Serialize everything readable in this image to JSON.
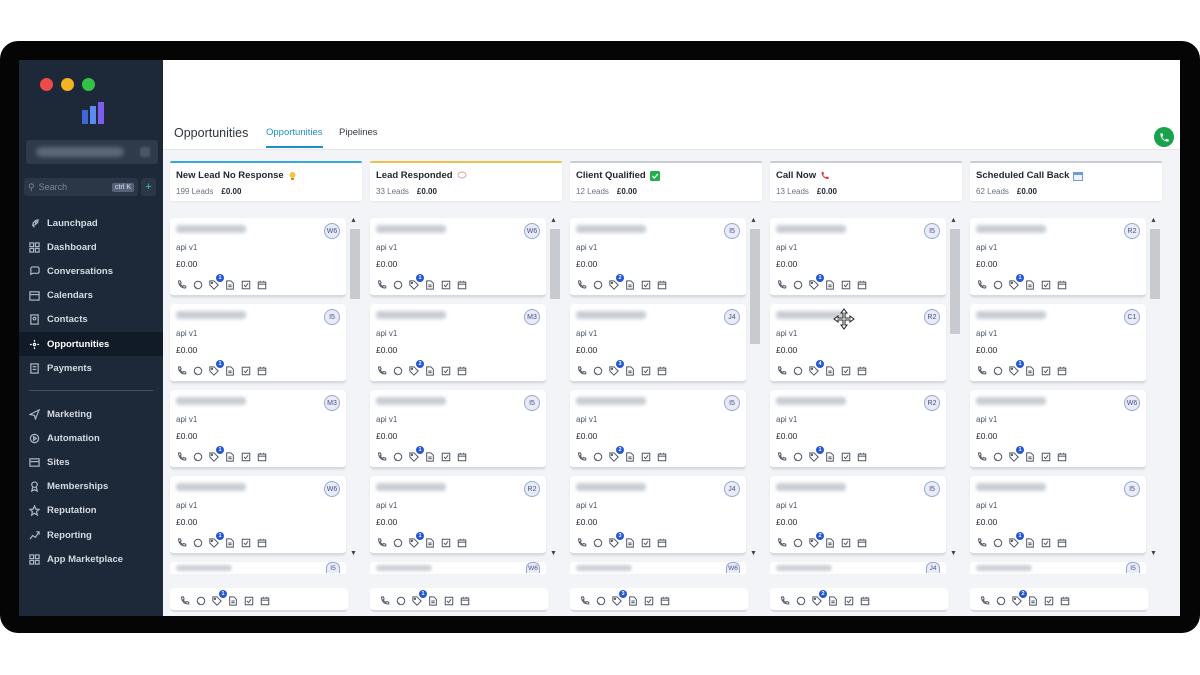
{
  "sidebar": {
    "search_placeholder": "Search",
    "search_shortcut": "ctrl K",
    "nav_items": [
      {
        "label": "Launchpad",
        "icon": "rocket-icon"
      },
      {
        "label": "Dashboard",
        "icon": "dashboard-icon"
      },
      {
        "label": "Conversations",
        "icon": "chat-icon"
      },
      {
        "label": "Calendars",
        "icon": "calendar-icon"
      },
      {
        "label": "Contacts",
        "icon": "contacts-icon"
      },
      {
        "label": "Opportunities",
        "icon": "opportunities-icon",
        "active": true
      },
      {
        "label": "Payments",
        "icon": "payments-icon"
      }
    ],
    "nav_items_2": [
      {
        "label": "Marketing",
        "icon": "send-icon"
      },
      {
        "label": "Automation",
        "icon": "automation-icon"
      },
      {
        "label": "Sites",
        "icon": "globe-icon"
      },
      {
        "label": "Memberships",
        "icon": "membership-icon"
      },
      {
        "label": "Reputation",
        "icon": "star-icon"
      },
      {
        "label": "Reporting",
        "icon": "chart-icon"
      },
      {
        "label": "App Marketplace",
        "icon": "grid-icon"
      }
    ]
  },
  "header": {
    "title": "Opportunities",
    "tabs": [
      "Opportunities",
      "Pipelines"
    ],
    "active_tab": "Opportunities"
  },
  "columns": [
    {
      "title": "New Lead No Response",
      "leads": "199 Leads",
      "amount": "£0.00",
      "color": "#39a7d8",
      "icon": "lightbulb-icon",
      "cards": [
        {
          "badge": "W6",
          "count": "1"
        },
        {
          "badge": "I5",
          "count": "1"
        },
        {
          "badge": "M3",
          "count": "1"
        },
        {
          "badge": "W6",
          "count": "1"
        }
      ],
      "peek_badge": "I5",
      "footer_count": "1"
    },
    {
      "title": "Lead Responded",
      "leads": "33 Leads",
      "amount": "£0.00",
      "color": "#e8c24a",
      "icon": "chat-bubble-icon",
      "cards": [
        {
          "badge": "W6",
          "count": "1"
        },
        {
          "badge": "M3",
          "count": "2"
        },
        {
          "badge": "I5",
          "count": "1"
        },
        {
          "badge": "R2",
          "count": "1"
        }
      ],
      "peek_badge": "W6",
      "footer_count": "1"
    },
    {
      "title": "Client Qualified",
      "leads": "12 Leads",
      "amount": "£0.00",
      "color": "#c9cdd3",
      "icon": "checkbox-icon",
      "cards": [
        {
          "badge": "I5",
          "count": "2"
        },
        {
          "badge": "J4",
          "count": "3"
        },
        {
          "badge": "I5",
          "count": "2"
        },
        {
          "badge": "J4",
          "count": "3"
        }
      ],
      "peek_badge": "W6",
      "footer_count": "3"
    },
    {
      "title": "Call Now",
      "leads": "13 Leads",
      "amount": "£0.00",
      "color": "#c9cdd3",
      "icon": "phone-icon",
      "cards": [
        {
          "badge": "I5",
          "count": "1"
        },
        {
          "badge": "R2",
          "count": "4"
        },
        {
          "badge": "R2",
          "count": "1"
        },
        {
          "badge": "I5",
          "count": "2"
        }
      ],
      "peek_badge": "J4",
      "footer_count": "2"
    },
    {
      "title": "Scheduled Call Back",
      "leads": "62 Leads",
      "amount": "£0.00",
      "color": "#c9cdd3",
      "icon": "calendar-icon",
      "cards": [
        {
          "badge": "R2",
          "count": "1"
        },
        {
          "badge": "C1",
          "count": "1"
        },
        {
          "badge": "W6",
          "count": "1"
        },
        {
          "badge": "I5",
          "count": "1"
        }
      ],
      "peek_badge": "I5",
      "footer_count": "2"
    }
  ],
  "card_source": "api v1",
  "card_amount": "£0.00"
}
